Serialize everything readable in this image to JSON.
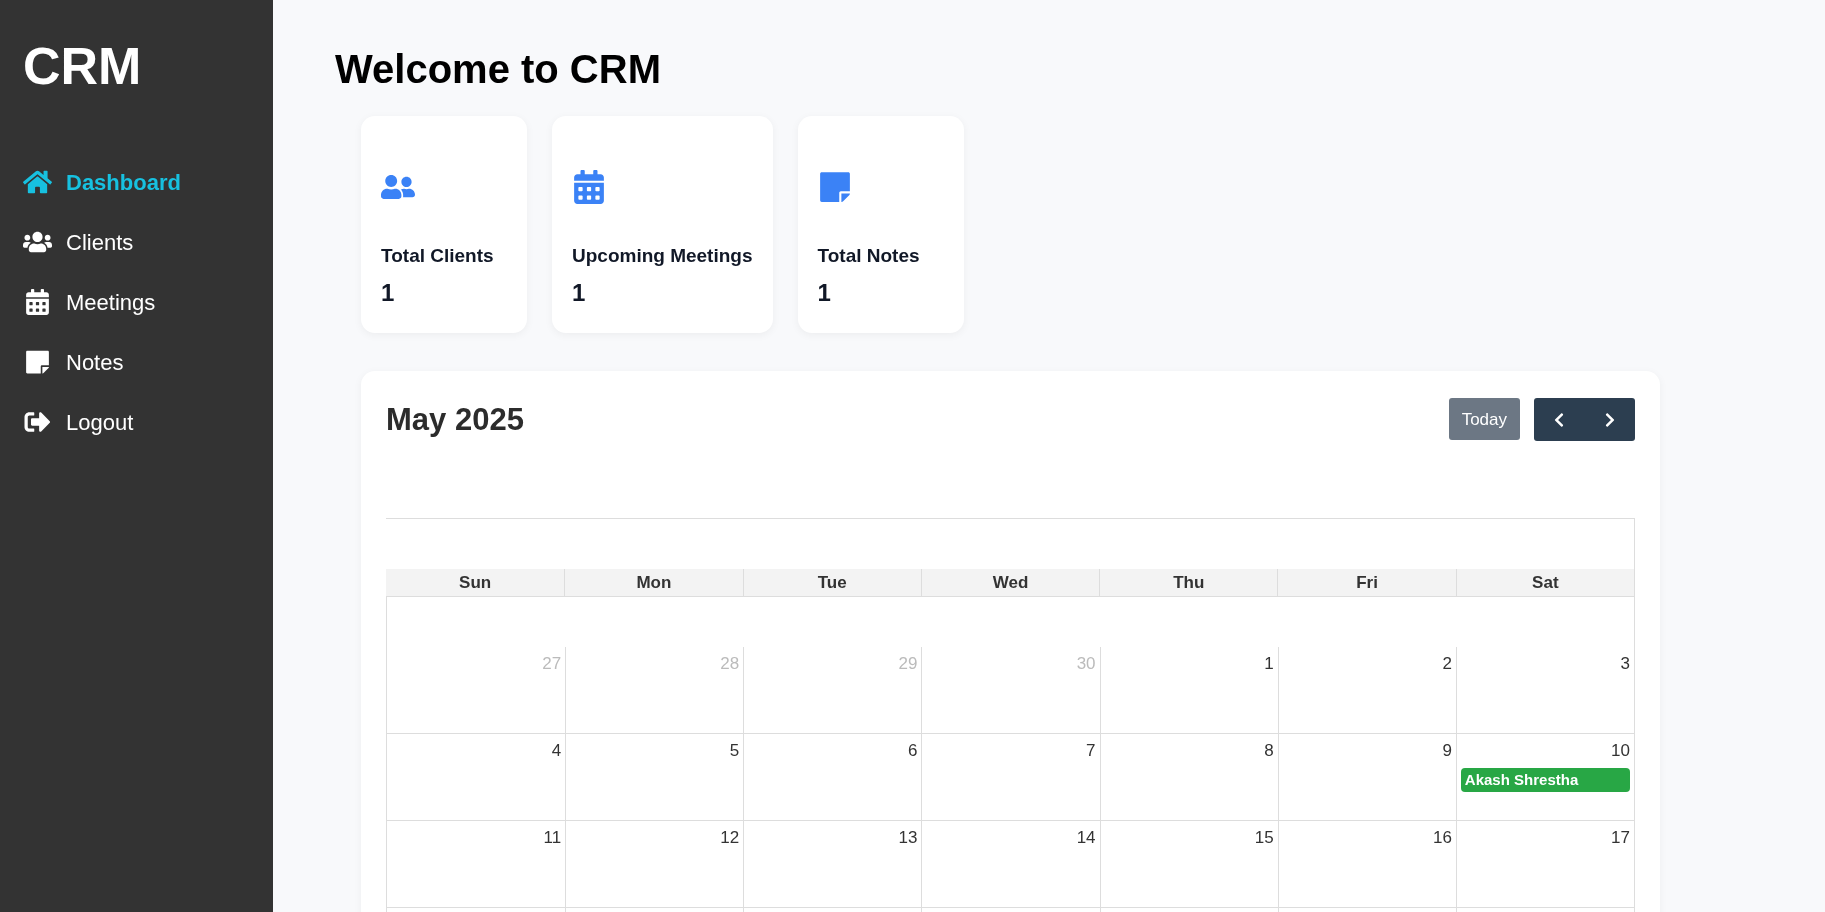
{
  "sidebar": {
    "logo": "CRM",
    "items": [
      {
        "label": "Dashboard",
        "selected": true
      },
      {
        "label": "Clients",
        "selected": false
      },
      {
        "label": "Meetings",
        "selected": false
      },
      {
        "label": "Notes",
        "selected": false
      },
      {
        "label": "Logout",
        "selected": false
      }
    ]
  },
  "page_title": "Welcome to CRM",
  "stats": [
    {
      "label": "Total Clients",
      "value": "1"
    },
    {
      "label": "Upcoming Meetings",
      "value": "1"
    },
    {
      "label": "Total Notes",
      "value": "1"
    }
  ],
  "calendar": {
    "title": "May 2025",
    "today_button": "Today",
    "weekdays": [
      "Sun",
      "Mon",
      "Tue",
      "Wed",
      "Thu",
      "Fri",
      "Sat"
    ],
    "weeks": [
      [
        {
          "day": "27",
          "muted": true
        },
        {
          "day": "28",
          "muted": true
        },
        {
          "day": "29",
          "muted": true
        },
        {
          "day": "30",
          "muted": true
        },
        {
          "day": "1",
          "muted": false
        },
        {
          "day": "2",
          "muted": false
        },
        {
          "day": "3",
          "muted": false
        }
      ],
      [
        {
          "day": "4",
          "muted": false
        },
        {
          "day": "5",
          "muted": false
        },
        {
          "day": "6",
          "muted": false
        },
        {
          "day": "7",
          "muted": false
        },
        {
          "day": "8",
          "muted": false
        },
        {
          "day": "9",
          "muted": false
        },
        {
          "day": "10",
          "muted": false,
          "events": [
            {
              "title": "Akash Shrestha",
              "color": "#28a745"
            }
          ]
        }
      ],
      [
        {
          "day": "11",
          "muted": false
        },
        {
          "day": "12",
          "muted": false
        },
        {
          "day": "13",
          "muted": false
        },
        {
          "day": "14",
          "muted": false
        },
        {
          "day": "15",
          "muted": false
        },
        {
          "day": "16",
          "muted": false
        },
        {
          "day": "17",
          "muted": false
        }
      ]
    ]
  }
}
